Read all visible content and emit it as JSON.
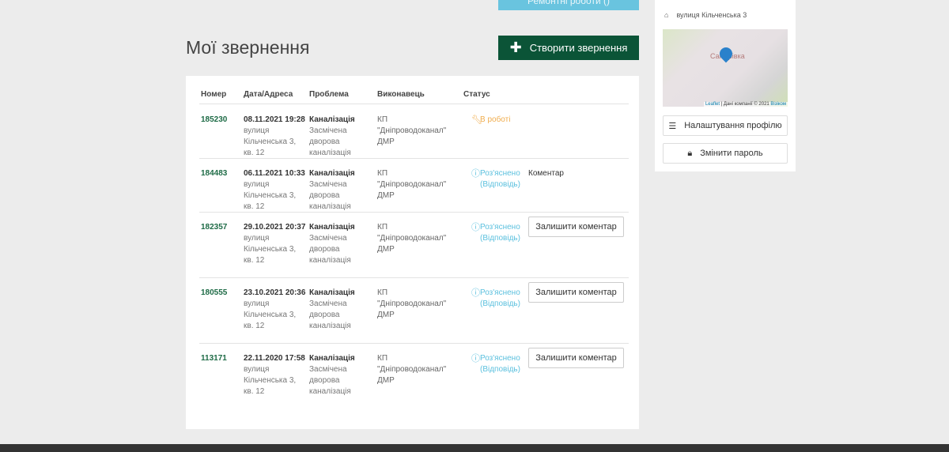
{
  "top_button": "Ремонтні роботи ()",
  "title": "Мої звернення",
  "create_button": "Створити звернення",
  "columns": [
    "Номер",
    "Дата/Адреса",
    "Проблема",
    "Виконавець",
    "Статус"
  ],
  "rows": [
    {
      "number": "185230",
      "date": "08.11.2021 19:28",
      "address": "вулиця Кільченська 3, кв. 12",
      "category": "Каналізація",
      "problem": "Засмічена дворова каналізація",
      "executor": "КП \"Дніпроводоканал\" ДМР",
      "status": "В роботі",
      "status_icon": "wrench-icon",
      "action": ""
    },
    {
      "number": "184483",
      "date": "06.11.2021 10:33",
      "address": "вулиця Кільченська 3, кв. 12",
      "category": "Каналізація",
      "problem": "Засмічена дворова каналізація",
      "executor": "КП \"Дніпроводоканал\" ДМР",
      "status": "Роз'яснено (Відповідь)",
      "status_icon": "info-icon",
      "action": "Коментар"
    },
    {
      "number": "182357",
      "date": "29.10.2021 20:37",
      "address": "вулиця Кільченська 3, кв. 12",
      "category": "Каналізація",
      "problem": "Засмічена дворова каналізація",
      "executor": "КП \"Дніпроводоканал\" ДМР",
      "status": "Роз'яснено (Відповідь)",
      "status_icon": "info-icon",
      "action": "Залишити коментар"
    },
    {
      "number": "180555",
      "date": "23.10.2021 20:36",
      "address": "вулиця Кільченська 3, кв. 12",
      "category": "Каналізація",
      "problem": "Засмічена дворова каналізація",
      "executor": "КП \"Дніпроводоканал\" ДМР",
      "status": "Роз'яснено (Відповідь)",
      "status_icon": "info-icon",
      "action": "Залишити коментар"
    },
    {
      "number": "113171",
      "date": "22.11.2020 17:58",
      "address": "вулиця Кільченська 3, кв. 12",
      "category": "Каналізація",
      "problem": "Засмічена дворова каналізація",
      "executor": "КП \"Дніпроводоканал\" ДМР",
      "status": "Роз'яснено (Відповідь)",
      "status_icon": "info-icon",
      "action": "Залишити коментар"
    }
  ],
  "sidebar": {
    "address": "вулиця Кільченська 3",
    "map_place": "Самарівка",
    "map_attribution_leaflet": "Leaflet",
    "map_attribution_text": " | Дані компанії © 2021 ",
    "map_attribution_link": "Візіком",
    "profile_button": "Налаштування профілю",
    "password_button": "Змінити пароль"
  },
  "colors": {
    "primary": "#0b5437",
    "info": "#5bc0de",
    "warning": "#f0ad4e",
    "link": "#1e6b46"
  }
}
